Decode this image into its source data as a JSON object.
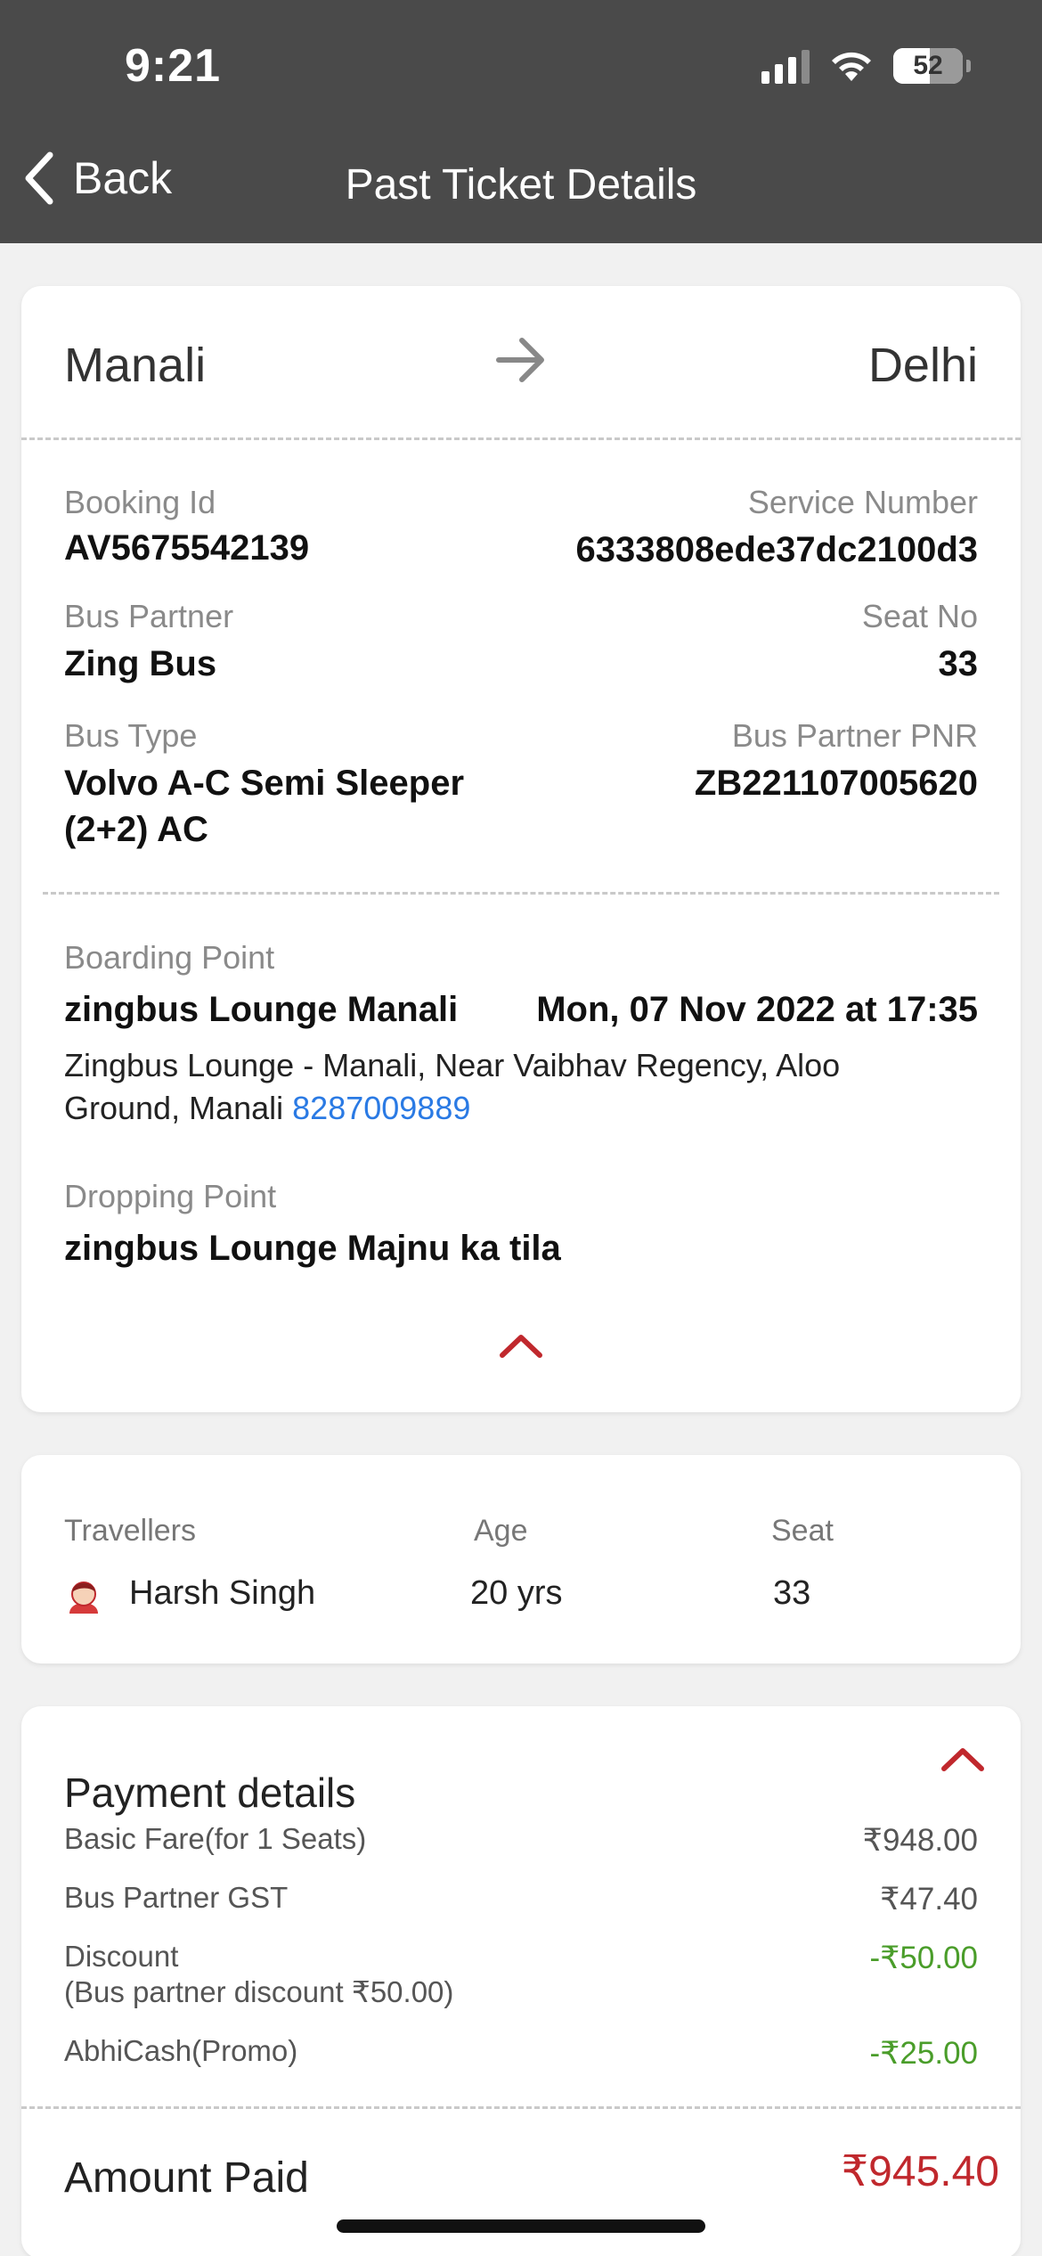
{
  "status_bar": {
    "time": "9:21",
    "battery": "52"
  },
  "header": {
    "back_label": "Back",
    "title": "Past Ticket Details"
  },
  "route": {
    "from": "Manali",
    "to": "Delhi"
  },
  "ticket": {
    "booking_id_label": "Booking Id",
    "booking_id": "AV5675542139",
    "service_number_label": "Service Number",
    "service_number": "6333808ede37dc2100d3",
    "bus_partner_label": "Bus Partner",
    "bus_partner": "Zing Bus",
    "seat_no_label": "Seat No",
    "seat_no": "33",
    "bus_type_label": "Bus Type",
    "bus_type_line1": "Volvo A-C Semi Sleeper",
    "bus_type_line2": "(2+2) AC",
    "pnr_label": "Bus Partner PNR",
    "pnr": "ZB221107005620"
  },
  "boarding": {
    "label": "Boarding Point",
    "name": "zingbus Lounge Manali",
    "datetime": "Mon, 07 Nov 2022 at 17:35",
    "address": "Zingbus Lounge - Manali, Near Vaibhav Regency, Aloo Ground, Manali",
    "phone": "8287009889"
  },
  "dropping": {
    "label": "Dropping Point",
    "name": "zingbus Lounge Majnu ka tila"
  },
  "travellers": {
    "headers": {
      "name": "Travellers",
      "age": "Age",
      "seat": "Seat"
    },
    "rows": [
      {
        "name": "Harsh Singh",
        "age": "20 yrs",
        "seat": "33"
      }
    ]
  },
  "payment": {
    "title": "Payment details",
    "basic_fare_label": "Basic Fare(for 1 Seats)",
    "basic_fare": "₹948.00",
    "gst_label": "Bus Partner GST",
    "gst": "₹47.40",
    "discount_label": "Discount",
    "discount_sub": "(Bus partner discount ₹50.00)",
    "discount": "-₹50.00",
    "promo_label": "AbhiCash(Promo)",
    "promo": "-₹25.00",
    "amount_paid_label": "Amount Paid",
    "amount_paid": "₹945.40"
  },
  "colors": {
    "accent_red": "#c0282d",
    "discount_green": "#4a9d2a",
    "link_blue": "#2a7ae4",
    "header_bg": "#4a4a4a"
  }
}
